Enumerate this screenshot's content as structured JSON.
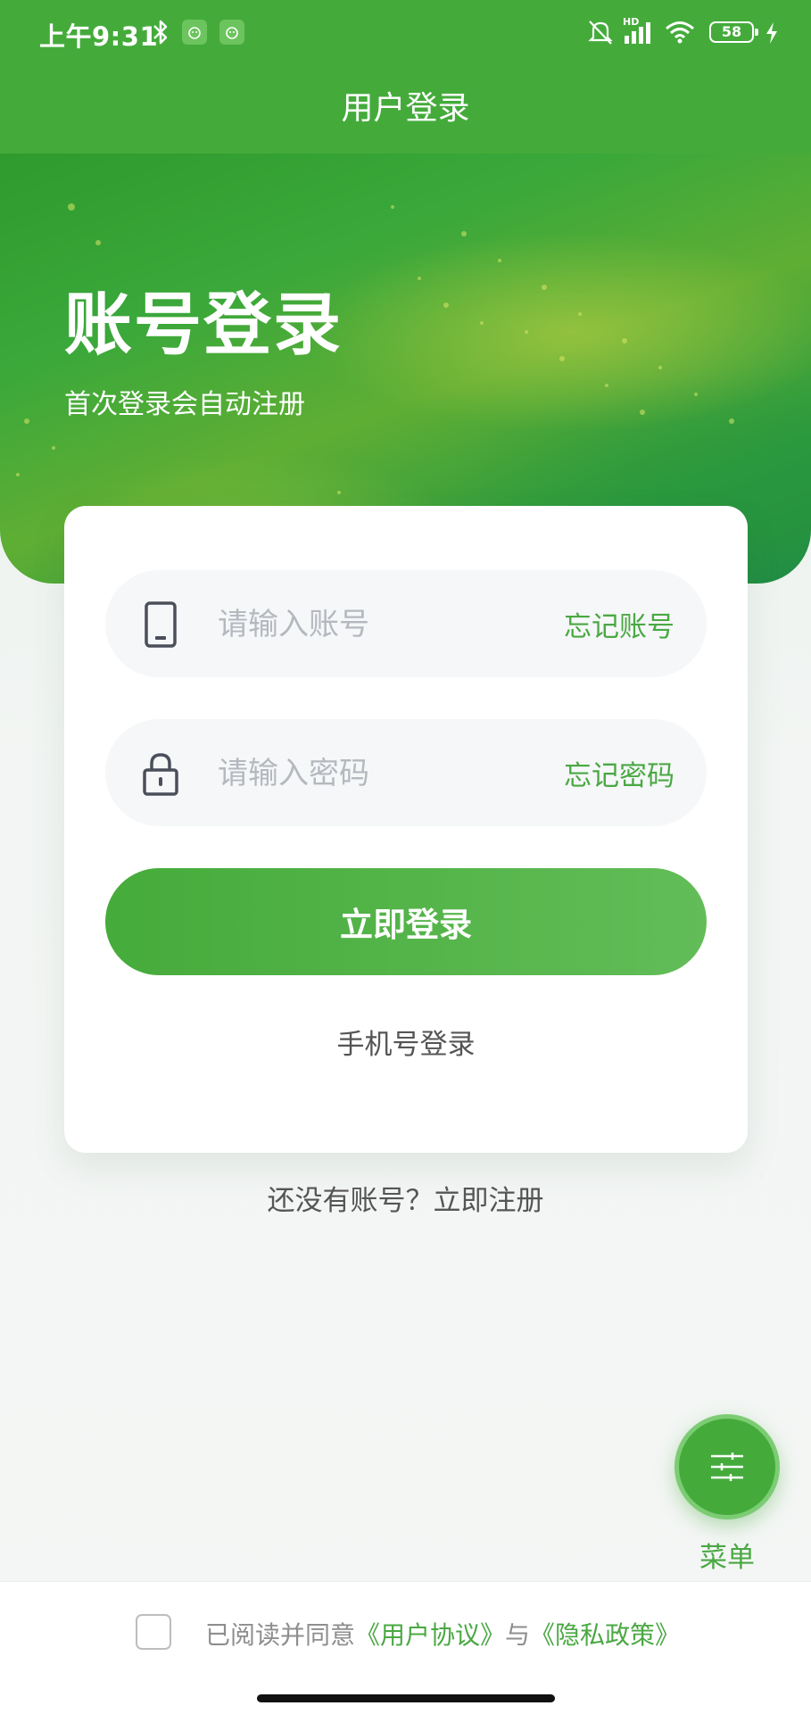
{
  "status_bar": {
    "time": "上午9:31",
    "network_label": "HD",
    "battery": "58",
    "icons": [
      "bluetooth-icon",
      "app-notification-icon",
      "app-notification-icon",
      "mute-bell-icon",
      "signal-icon",
      "wifi-icon",
      "battery-icon",
      "charging-icon"
    ]
  },
  "header": {
    "title": "用户登录"
  },
  "hero": {
    "title": "账号登录",
    "subtitle": "首次登录会自动注册"
  },
  "form": {
    "account": {
      "placeholder": "请输入账号",
      "icon": "phone-icon",
      "forgot_label": "忘记账号"
    },
    "password": {
      "placeholder": "请输入密码",
      "icon": "lock-icon",
      "forgot_label": "忘记密码"
    },
    "login_button": "立即登录",
    "phone_login": "手机号登录"
  },
  "register_link": "还没有账号？立即注册",
  "fab": {
    "label": "菜单",
    "icon": "menu-icon"
  },
  "footer": {
    "agree_prefix": "已阅读并同意",
    "user_agreement": "《用户协议》",
    "connector": "与",
    "privacy_policy": "《隐私政策》"
  },
  "colors": {
    "brand": "#44ab3b",
    "link": "#4aa843",
    "placeholder": "#b5b9bf"
  }
}
